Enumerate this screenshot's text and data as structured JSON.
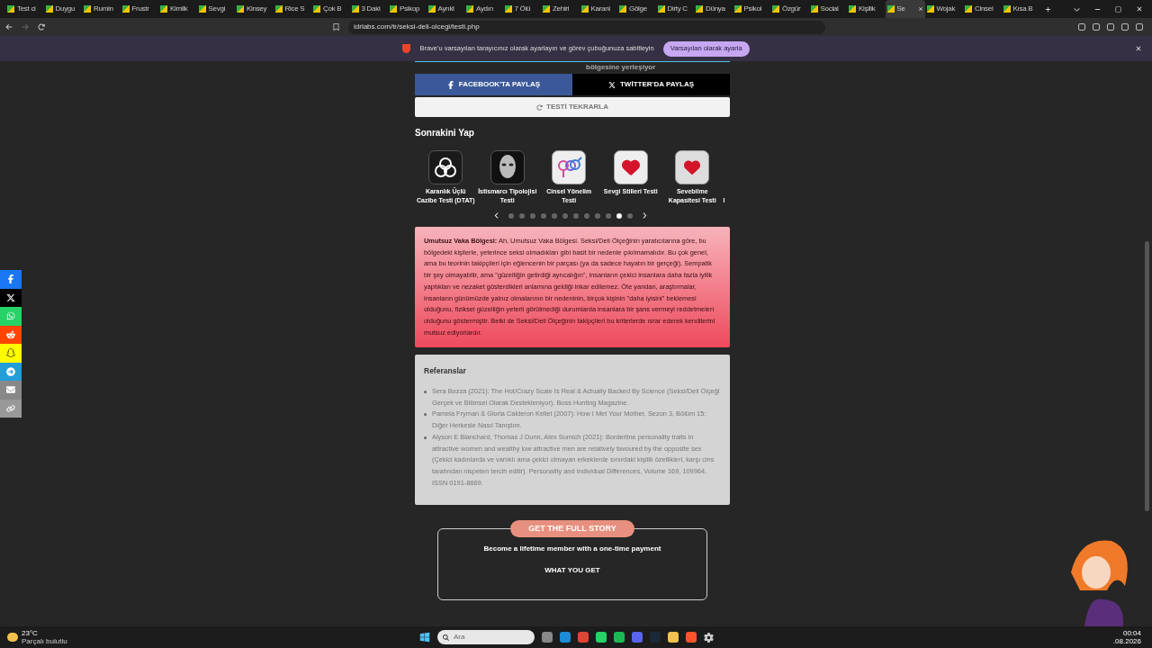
{
  "browser": {
    "tabs": [
      {
        "label": "Test ci",
        "selected": false
      },
      {
        "label": "Duygu",
        "selected": false
      },
      {
        "label": "Rumin",
        "selected": false
      },
      {
        "label": "Frustr",
        "selected": false
      },
      {
        "label": "Kimlik",
        "selected": false
      },
      {
        "label": "Sevgi",
        "selected": false
      },
      {
        "label": "Kinsey",
        "selected": false
      },
      {
        "label": "Rice S",
        "selected": false
      },
      {
        "label": "Çok B",
        "selected": false
      },
      {
        "label": "3 Daki",
        "selected": false
      },
      {
        "label": "Psikop",
        "selected": false
      },
      {
        "label": "Ayrıkl",
        "selected": false
      },
      {
        "label": "Aydın",
        "selected": false
      },
      {
        "label": "7 Ölü",
        "selected": false
      },
      {
        "label": "Zehirl",
        "selected": false
      },
      {
        "label": "Karanl",
        "selected": false
      },
      {
        "label": "Gölge",
        "selected": false
      },
      {
        "label": "Dirty C",
        "selected": false
      },
      {
        "label": "Dünya",
        "selected": false
      },
      {
        "label": "Psikol",
        "selected": false
      },
      {
        "label": "Özgür",
        "selected": false
      },
      {
        "label": "Social",
        "selected": false
      },
      {
        "label": "Kişilik",
        "selected": false
      },
      {
        "label": "Se",
        "selected": true
      },
      {
        "label": "Wojak",
        "selected": false
      },
      {
        "label": "Cinsel",
        "selected": false
      },
      {
        "label": "Kısa B",
        "selected": false
      }
    ],
    "address": "idrlabs.com/tr/seksi-deli-olcegi/testi.php"
  },
  "banner": {
    "message": "Brave'u varsayılan tarayıcınız olarak ayarlayın ve görev çubuğunuza sabitleyin",
    "button": "Varsayılan olarak ayarla"
  },
  "page": {
    "cut_text": "bölgesine yerleşiyor",
    "share_buttons": [
      {
        "label": "FACEBOOK'TA PAYLAŞ",
        "kind": "facebook"
      },
      {
        "label": "TWİTTER'DA PAYLAŞ",
        "kind": "twitter"
      }
    ],
    "retake": "TESTİ TEKRARLA",
    "next_heading": "Sonrakini Yap",
    "next_tests": [
      {
        "title": "Karanlık Üçlü Cazibe Testi (DTAT)",
        "partial": false
      },
      {
        "title": "İstismarcı Tipolojisi Testi",
        "partial": false
      },
      {
        "title": "Cinsel Yönelim Testi",
        "partial": false
      },
      {
        "title": "Sevgi Stilleri Testi",
        "partial": false
      },
      {
        "title": "Sevebilme Kapasitesi Testi",
        "partial": false
      },
      {
        "title": "I",
        "partial": true
      }
    ],
    "carousel_dots": [
      {
        "selected": false
      },
      {
        "selected": false
      },
      {
        "selected": false
      },
      {
        "selected": false
      },
      {
        "selected": false
      },
      {
        "selected": false
      },
      {
        "selected": false
      },
      {
        "selected": false
      },
      {
        "selected": false
      },
      {
        "selected": false
      },
      {
        "selected": true
      },
      {
        "selected": false
      }
    ],
    "result": "**Umutsuz Vaka Bölgesi:** Ah, Umutsuz Vaka Bölgesi. Seksi/Deli Ölçeğinin yaratıcılarına göre, bu bölgedeki kişilerle, yeterince seksi olmadıkları gibi basit bir nedenle çıkılmamalıdır. Bu çok genel, ama bu teorinin takipçileri için eğlencenin bir parçası (ya da sadece hayatın bir gerçeği). Sempatik bir şey olmayabilir, ama \"güzelliğin getirdiği ayrıcalığın\", insanların çekici insanlara daha fazla iyilik yaptıkları ve nezaket gösterdikleri anlamına geldiği inkar edilemez. Öte yandan, araştırmalar, insanların günümüzde yalnız olmalarının bir nedeninin, birçok kişinin \"daha iyisini\" beklemesi olduğunu, fiziksel güzelliğin yeterli görülmediği durumlarda insanlara bir şans vermeyi reddetmeleri olduğunu göstermiştir. Belki de Seksi/Deli Ölçeğinin takipçileri bu kriterlerde ısrar ederek kendilerini mutsuz ediyorlardır.",
    "references": {
      "title": "Referanslar",
      "items": [
        "Sera Bozza (2021): The Hot/Crazy Scale Is Real & Actually Backed By Science (Seksi/Deli Ölçeği Gerçek ve Bilimsel Olarak Destekleniyor). Boss Hunting Magazine.",
        "Pamela Fryman & Gloria Calderon Kellet (2007): How I Met Your Mother, Sezon 3, Bölüm 15: Diğer Herkesle Nasıl Tanıştım.",
        "Alyson E Blanchard, Thomas J Dunn, Alex Sumich (2021): Borderline personality traits in attractive women and wealthy low attractive men are relatively favoured by the opposite sex (Çekici kadınlarda ve varlıklı ama çekici olmayan erkeklerde sınırdaki kişilik özellikleri, karşı cins tarafından nispeten tercih edilir). Personality and Individual Differences, Volume 169, 109964, ISSN 0191-8869."
      ]
    },
    "promo": {
      "badge": "GET THE FULL STORY",
      "headline": "Become a lifetime member with a one-time payment",
      "subheading": "WHAT YOU GET"
    }
  },
  "taskbar": {
    "temperature": "23°C",
    "weather": "Parçalı bulutlu",
    "search_placeholder": "Ara",
    "time": "00:04",
    "date": ".08.2026"
  }
}
